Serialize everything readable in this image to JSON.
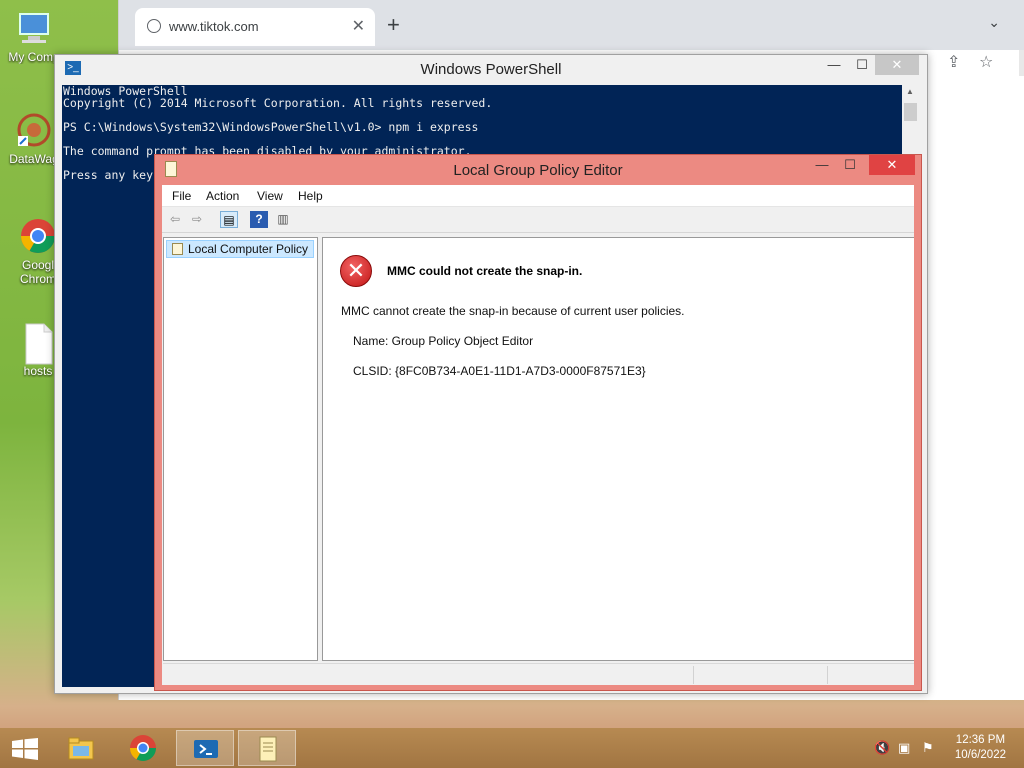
{
  "desktop": {
    "icons": [
      {
        "label": "My Comp",
        "icon": "computer-icon"
      },
      {
        "label": "DataWag",
        "icon": "datawag-icon"
      },
      {
        "label": "Googl Chrom",
        "icon": "chrome-icon"
      },
      {
        "label": "hosts",
        "icon": "file-icon"
      }
    ]
  },
  "chrome": {
    "tab_url": "www.tiktok.com",
    "tab_close": "✕",
    "new_tab": "+",
    "tab_menu": "⌄"
  },
  "powershell": {
    "title": "Windows PowerShell",
    "lines": [
      "Windows PowerShell",
      "Copyright (C) 2014 Microsoft Corporation. All rights reserved.",
      "",
      "PS C:\\Windows\\System32\\WindowsPowerShell\\v1.0> npm i express",
      "",
      "The command prompt has been disabled by your administrator.",
      "",
      "Press any key"
    ]
  },
  "gpo": {
    "title": "Local Group Policy Editor",
    "menu": [
      "File",
      "Action",
      "View",
      "Help"
    ],
    "tree_root": "Local Computer Policy",
    "error_title": "MMC could not create the snap-in.",
    "error_message": "MMC cannot create the snap-in because of current user policies.",
    "name_line": "Name: Group Policy Object Editor",
    "clsid_line": "CLSID: {8FC0B734-A0E1-11D1-A7D3-0000F87571E3}"
  },
  "window_buttons": {
    "minimize": "—",
    "maximize": "☐",
    "close": "✕"
  },
  "taskbar": {
    "time": "12:36 PM",
    "date": "10/6/2022"
  }
}
